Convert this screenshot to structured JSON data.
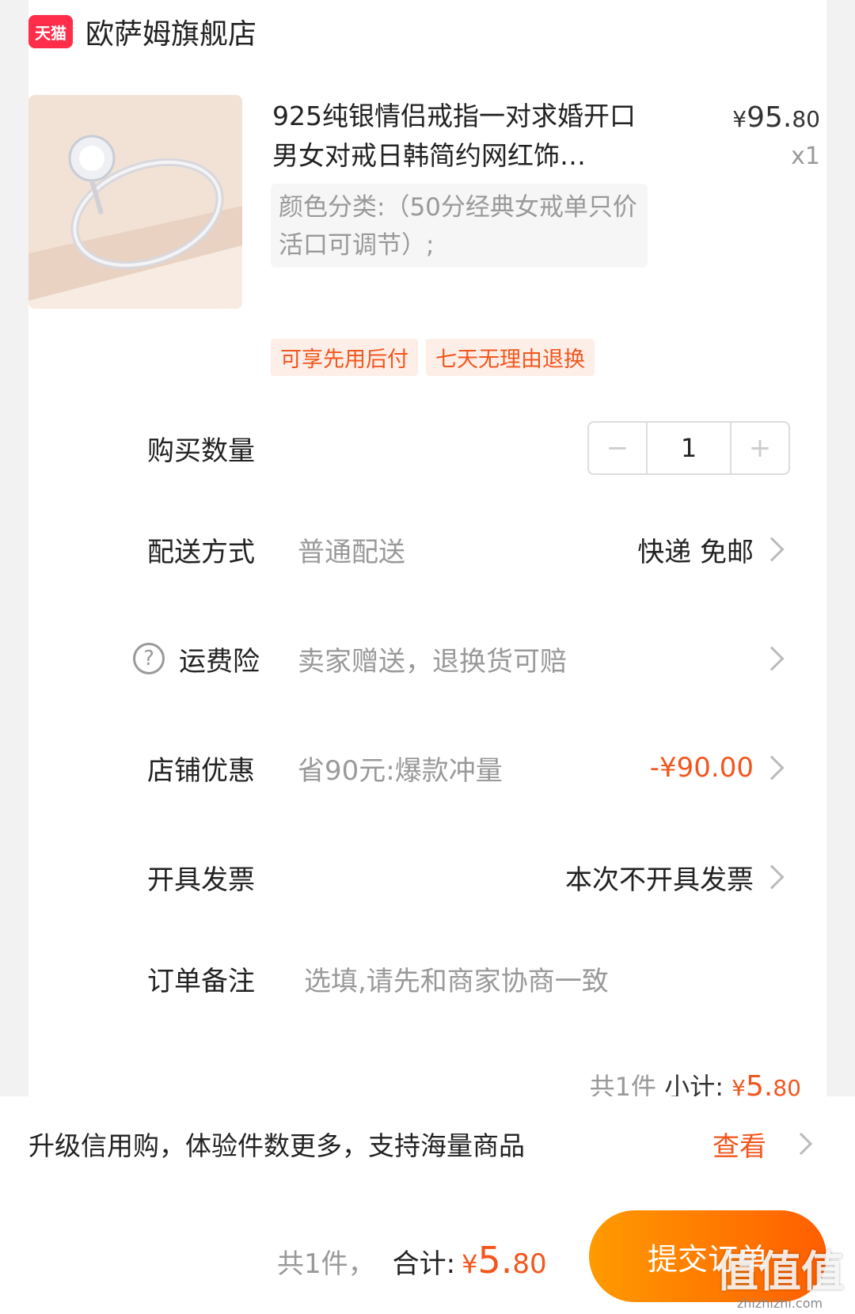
{
  "shop": {
    "badge": "天猫",
    "name": "欧萨姆旗舰店"
  },
  "product": {
    "title": "925纯银情侣戒指一对求婚开口男女对戒日韩简约网红饰…",
    "price_yen": "¥",
    "price_int": "95.",
    "price_dec": "80",
    "qty_label": "x1",
    "sku": "颜色分类:（50分经典女戒单只价活口可调节）;",
    "tags": [
      "可享先用后付",
      "七天无理由退换"
    ]
  },
  "quantity": {
    "label": "购买数量",
    "minus": "−",
    "value": "1",
    "plus": "+"
  },
  "delivery": {
    "label": "配送方式",
    "value": "普通配送",
    "right": "快递 免邮"
  },
  "insurance": {
    "help_icon": "?",
    "label": "运费险",
    "value": "卖家赠送，退换货可赔"
  },
  "discount": {
    "label": "店铺优惠",
    "value": "省90元:爆款冲量",
    "right": "-¥90.00"
  },
  "invoice": {
    "label": "开具发票",
    "right": "本次不开具发票"
  },
  "remark": {
    "label": "订单备注",
    "placeholder": "选填,请先和商家协商一致"
  },
  "subtotal": {
    "count": "共1件",
    "label": "小计:",
    "yen": "¥",
    "int": "5.",
    "dec": "80"
  },
  "promo": {
    "text": "升级信用购，体验件数更多，支持海量商品",
    "link": "查看"
  },
  "footer": {
    "count": "共1件，",
    "label": "合计:",
    "yen": "¥",
    "int": "5.",
    "dec": "80",
    "submit": "提交订单"
  },
  "watermark": {
    "logo": "值值值",
    "url": "zhizhizhi.com"
  },
  "colors": {
    "accent": "#f2561d",
    "button_start": "#ff9a00",
    "button_end": "#ff5e00",
    "tmall_red": "#ff2d4a"
  }
}
